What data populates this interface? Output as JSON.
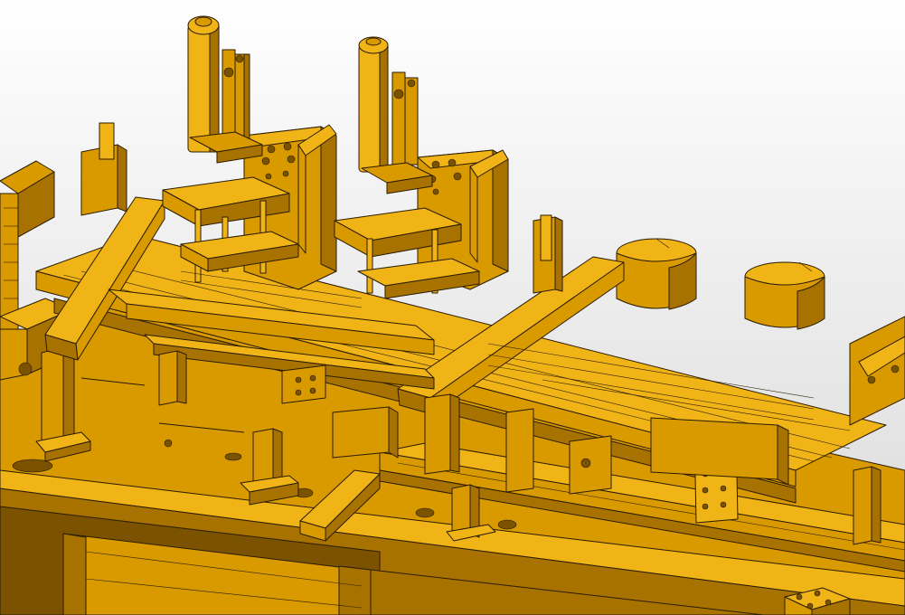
{
  "viewport": {
    "background_top": "#ffffff",
    "background_bottom": "#d9d9d9"
  },
  "model": {
    "face_color": "#d99a00",
    "light_color": "#f0b417",
    "dark_color": "#a87200",
    "shadow_color": "#7a5200",
    "edge_color": "#2a1c00"
  }
}
